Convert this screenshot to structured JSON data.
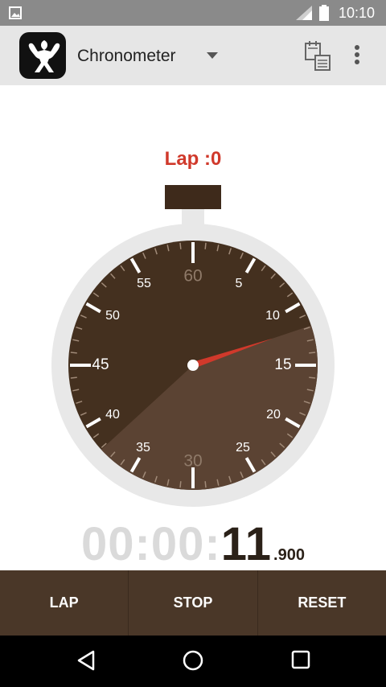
{
  "status": {
    "time": "10:10"
  },
  "toolbar": {
    "title": "Chronometer"
  },
  "lap": {
    "label": "Lap :0"
  },
  "dial": {
    "minor_numbers": [
      "5",
      "10",
      "15",
      "20",
      "25",
      "35",
      "40",
      "45",
      "50",
      "55"
    ],
    "faint_numbers": [
      "60",
      "30"
    ],
    "hand_seconds": 11.9
  },
  "timer": {
    "dim": "00:00:",
    "seconds": "11",
    "millis": ".900"
  },
  "buttons": {
    "lap": "LAP",
    "stop": "STOP",
    "reset": "RESET"
  },
  "colors": {
    "status_bar": "#8a8a8a",
    "toolbar": "#e6e6e6",
    "dial_face": "#44301f",
    "dial_sweep": "#5b4333",
    "hand": "#d0392b",
    "button_bar": "#4a3728",
    "lap_text": "#d0392b"
  }
}
